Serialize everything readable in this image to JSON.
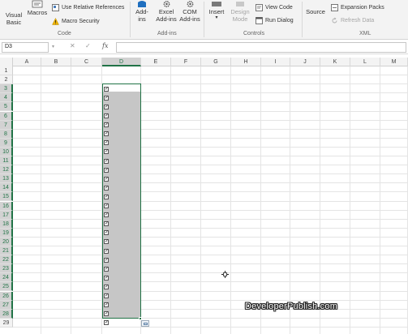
{
  "ribbon": {
    "code": {
      "visual_basic": "Visual\nBasic",
      "macros": "Macros",
      "use_relative_references": "Use Relative References",
      "macro_security": "Macro Security",
      "label": "Code"
    },
    "addins": {
      "addins": "Add-\nins",
      "excel_addins": "Excel\nAdd-ins",
      "com_addins": "COM\nAdd-ins",
      "label": "Add-ins"
    },
    "controls": {
      "insert": "Insert",
      "design_mode": "Design\nMode",
      "view_code": "View Code",
      "run_dialog": "Run Dialog",
      "label": "Controls"
    },
    "xml": {
      "source": "Source",
      "expansion_packs": "Expansion Packs",
      "refresh_data": "Refresh Data",
      "label": "XML"
    }
  },
  "formula_bar": {
    "name_box": "D3",
    "cancel": "✕",
    "enter": "✓",
    "fx": "fx",
    "value": ""
  },
  "columns": [
    "A",
    "B",
    "C",
    "D",
    "E",
    "F",
    "G",
    "H",
    "I",
    "J",
    "K",
    "L",
    "M"
  ],
  "rows": [
    "1",
    "2",
    "3",
    "4",
    "5",
    "6",
    "7",
    "8",
    "9",
    "10",
    "11",
    "12",
    "13",
    "14",
    "15",
    "16",
    "17",
    "18",
    "19",
    "20",
    "21",
    "22",
    "23",
    "24",
    "25",
    "26",
    "27",
    "28",
    "29"
  ],
  "selected": {
    "column": "D",
    "name": "D3"
  },
  "checkbox_mark": "✓",
  "watermark": "DeveloperPublish.com"
}
